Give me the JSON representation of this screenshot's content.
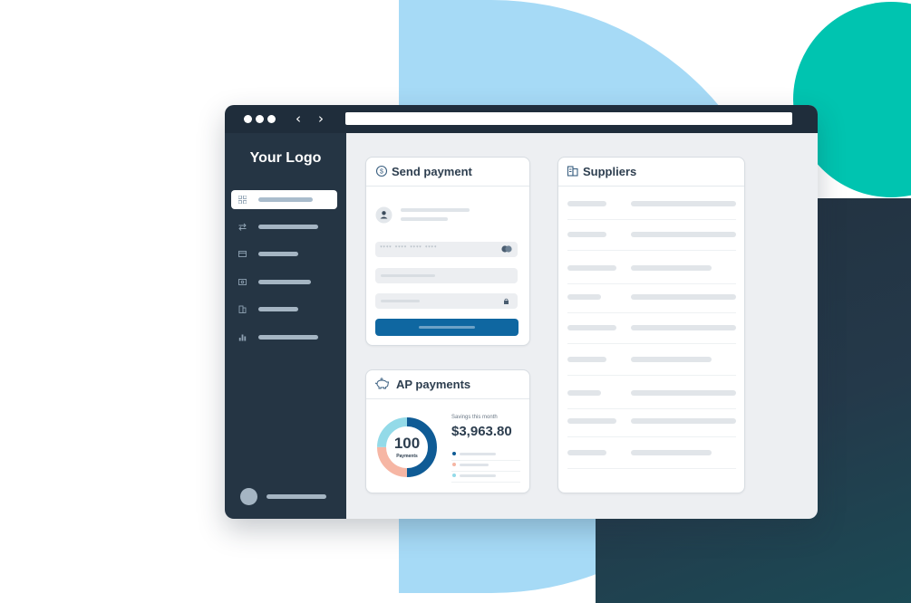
{
  "sidebar": {
    "logo": "Your Logo",
    "items": [
      {
        "icon": "dashboard-grid-icon",
        "active": true
      },
      {
        "icon": "transfer-arrows-icon",
        "active": false
      },
      {
        "icon": "credit-card-icon",
        "active": false
      },
      {
        "icon": "cash-icon",
        "active": false
      },
      {
        "icon": "building-icon",
        "active": false
      },
      {
        "icon": "bar-chart-icon",
        "active": false
      }
    ]
  },
  "send_payment": {
    "title": "Send payment",
    "icon": "dollar-circle-icon",
    "card_number_mask": "**** **** **** ****"
  },
  "suppliers": {
    "title": "Suppliers",
    "icon": "building-icon"
  },
  "ap_payments": {
    "title": "AP payments",
    "icon": "piggy-bank-icon",
    "count": "100",
    "count_label": "Payments",
    "savings_label": "Savings this month",
    "savings_value": "$3,963.80",
    "donut_fractions": [
      0.5,
      0.25,
      0.25
    ],
    "legend_colors": [
      "#0f5b95",
      "#f6b6a4",
      "#93dae8"
    ]
  },
  "colors": {
    "primary": "#0f67a1",
    "navy": "#0f5b95",
    "peach": "#f6b6a4",
    "light_blue": "#93dae8",
    "sidebar": "#253544",
    "teal": "#00c4b0"
  }
}
